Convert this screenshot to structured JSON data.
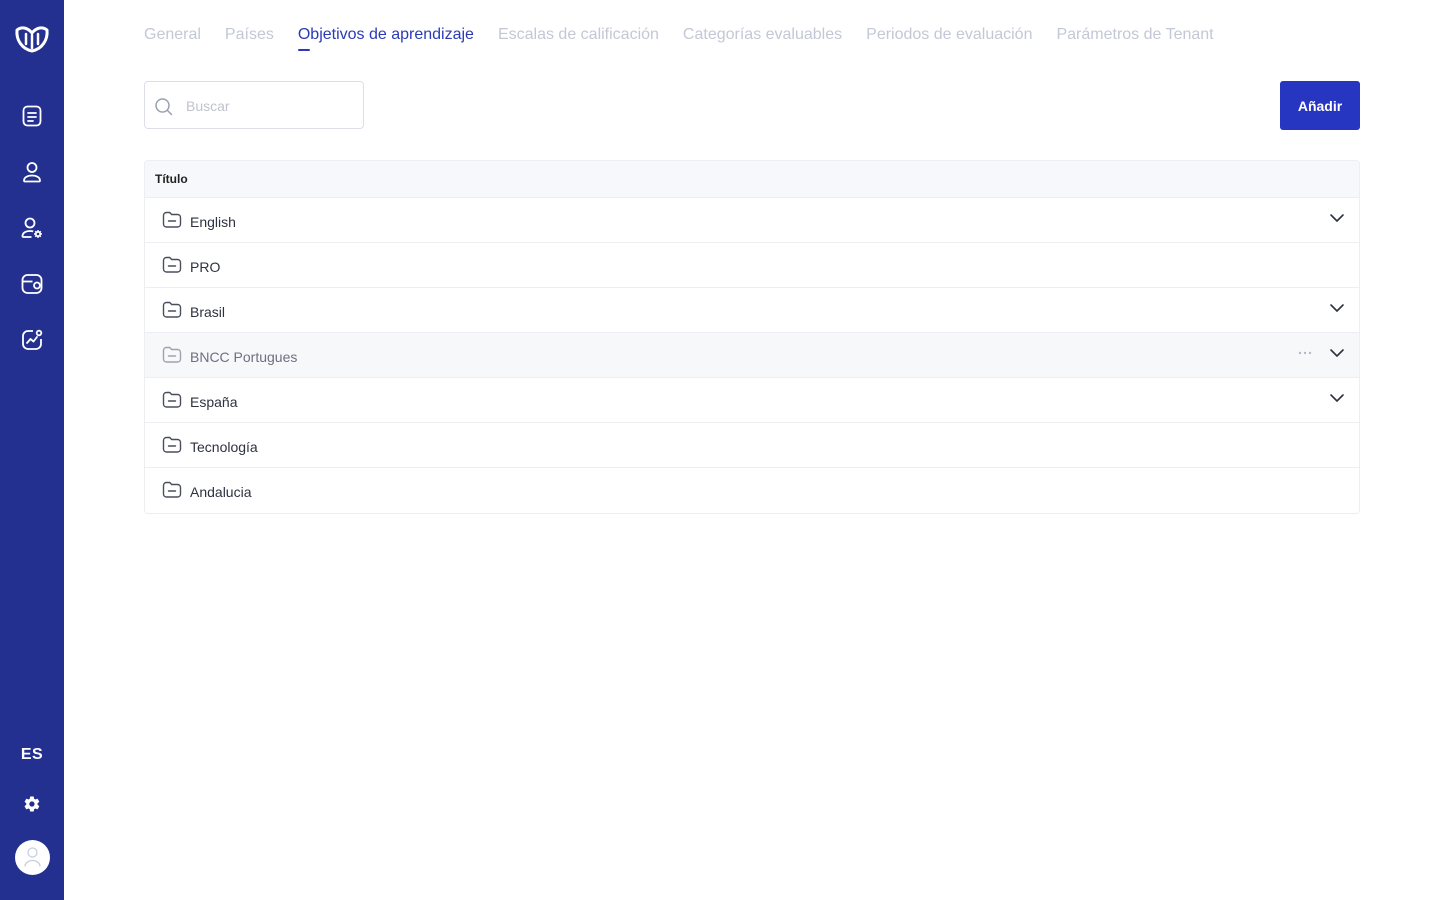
{
  "sidebar": {
    "language": "ES",
    "icons": [
      "logo-icon",
      "document-icon",
      "user-icon",
      "user-settings-icon",
      "wallet-icon",
      "analytics-icon",
      "gear-icon",
      "avatar-icon"
    ]
  },
  "tabs": [
    {
      "label": "General",
      "active": false
    },
    {
      "label": "Países",
      "active": false
    },
    {
      "label": "Objetivos de aprendizaje",
      "active": true
    },
    {
      "label": "Escalas de calificación",
      "active": false
    },
    {
      "label": "Categorías evaluables",
      "active": false
    },
    {
      "label": "Periodos de evaluación",
      "active": false
    },
    {
      "label": "Parámetros de Tenant",
      "active": false
    }
  ],
  "search": {
    "placeholder": "Buscar",
    "value": ""
  },
  "add_button": {
    "label": "Añadir"
  },
  "table": {
    "header": "Título",
    "rows": [
      {
        "label": "English",
        "expandable": true
      },
      {
        "label": "PRO",
        "expandable": false
      },
      {
        "label": "Brasil",
        "expandable": true
      },
      {
        "label": "BNCC Portugues",
        "expandable": true,
        "hovered": true
      },
      {
        "label": "España",
        "expandable": true
      },
      {
        "label": "Tecnología",
        "expandable": false
      },
      {
        "label": "Andalucia",
        "expandable": false
      }
    ]
  },
  "colors": {
    "sidebar": "#24308f",
    "accent": "#2636c1",
    "tab_active": "#2b3bb8",
    "tab_inactive": "#c3c8d6"
  }
}
